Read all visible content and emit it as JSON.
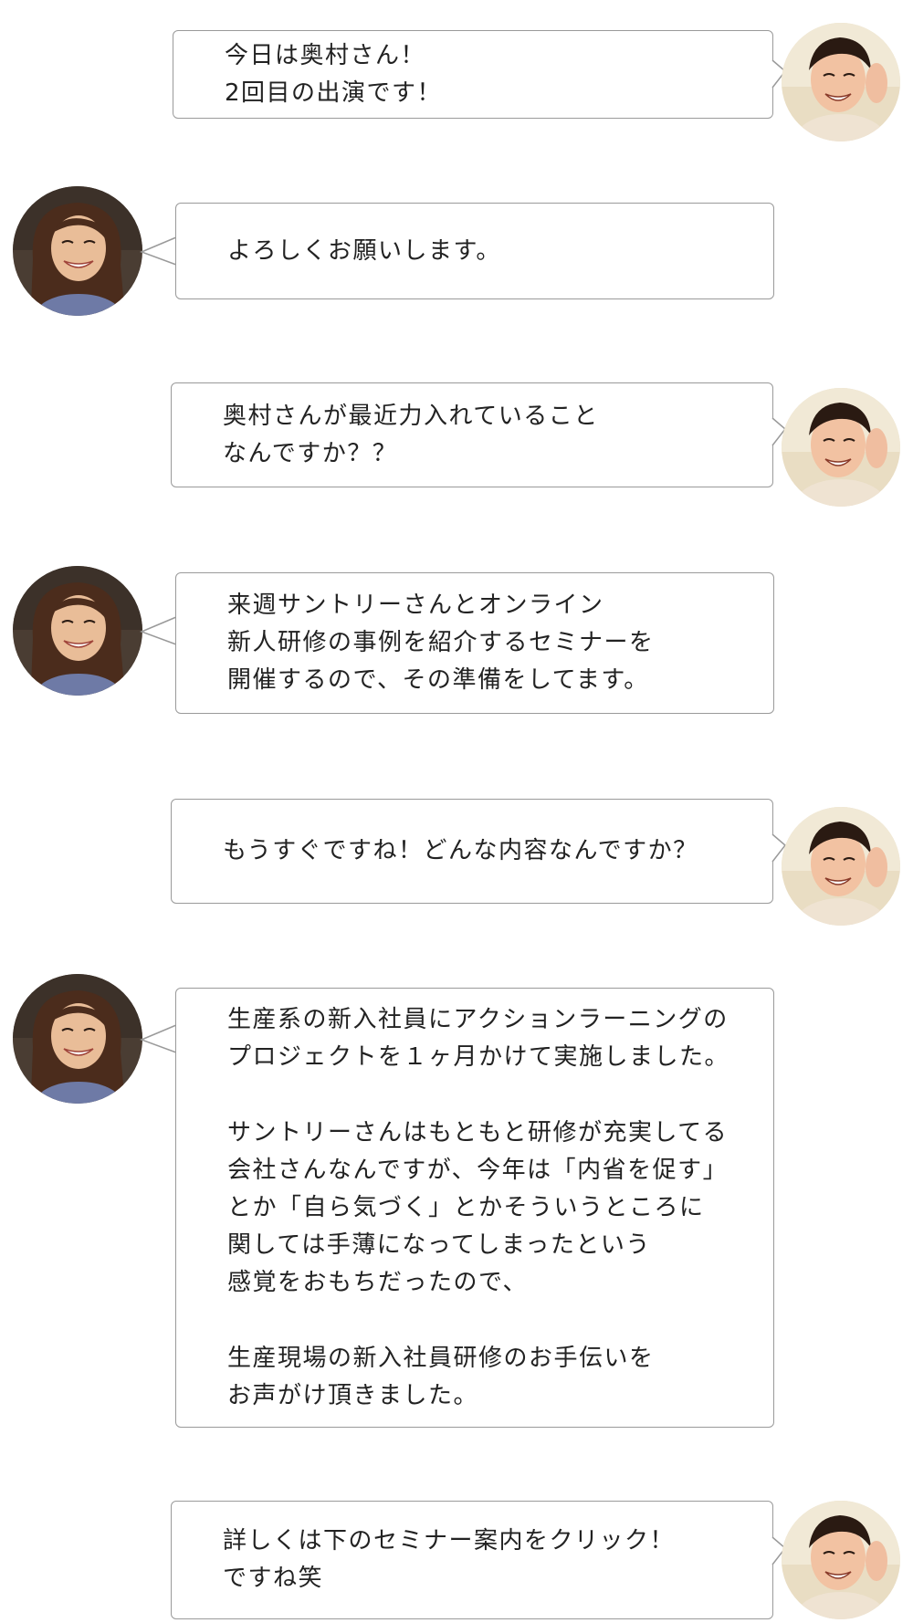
{
  "messages": [
    {
      "speaker": "interviewer",
      "lines": [
        "今日は奥村さん！",
        "2回目の出演です！"
      ]
    },
    {
      "speaker": "okumura",
      "lines": [
        "よろしくお願いします。"
      ]
    },
    {
      "speaker": "interviewer",
      "lines": [
        "奥村さんが最近力入れていること",
        "なんですか？？"
      ]
    },
    {
      "speaker": "okumura",
      "lines": [
        "来週サントリーさんとオンライン",
        "新人研修の事例を紹介するセミナーを",
        "開催するので、その準備をしてます。"
      ]
    },
    {
      "speaker": "interviewer",
      "lines": [
        "もうすぐですね！どんな内容なんですか？"
      ]
    },
    {
      "speaker": "okumura",
      "lines": [
        "生産系の新入社員にアクションラーニングの",
        "プロジェクトを１ヶ月かけて実施しました。",
        "",
        "サントリーさんはもともと研修が充実してる",
        "会社さんなんですが、今年は「内省を促す」",
        "とか「自ら気づく」とかそういうところに",
        "関しては手薄になってしまったという",
        "感覚をおもちだったので、",
        "",
        "生産現場の新入社員研修のお手伝いを",
        "お声がけ頂きました。"
      ]
    },
    {
      "speaker": "interviewer",
      "lines": [
        "詳しくは下のセミナー案内をクリック！",
        "ですね笑"
      ]
    }
  ]
}
